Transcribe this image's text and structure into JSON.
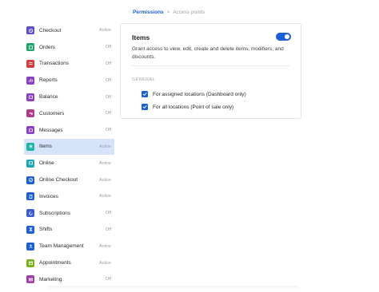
{
  "breadcrumb": {
    "link": "Permissions",
    "separator": ">",
    "current": "Access points"
  },
  "sidebar": {
    "items": [
      {
        "label": "Checkout",
        "status": "Active",
        "icon": "checkout-icon",
        "color": "#5b4bd6"
      },
      {
        "label": "Orders",
        "status": "Off",
        "icon": "orders-icon",
        "color": "#20a46b"
      },
      {
        "label": "Transactions",
        "status": "Off",
        "icon": "transactions-icon",
        "color": "#d93c3c"
      },
      {
        "label": "Reports",
        "status": "Off",
        "icon": "reports-icon",
        "color": "#8b3fc7"
      },
      {
        "label": "Balance",
        "status": "Off",
        "icon": "balance-icon",
        "color": "#8b3fc7"
      },
      {
        "label": "Customers",
        "status": "Off",
        "icon": "customers-icon",
        "color": "#b23a8a"
      },
      {
        "label": "Messages",
        "status": "Off",
        "icon": "messages-icon",
        "color": "#8b3fc7"
      },
      {
        "label": "Items",
        "status": "Active",
        "icon": "items-icon",
        "color": "#20b2aa",
        "selected": true
      },
      {
        "label": "Online",
        "status": "Active",
        "icon": "online-icon",
        "color": "#1aa6b7"
      },
      {
        "label": "Online Checkout",
        "status": "Active",
        "icon": "online-checkout-icon",
        "color": "#1a5fd6"
      },
      {
        "label": "Invoices",
        "status": "Active",
        "icon": "invoices-icon",
        "color": "#1a5fd6"
      },
      {
        "label": "Subscriptions",
        "status": "Off",
        "icon": "subscriptions-icon",
        "color": "#3b5bd6"
      },
      {
        "label": "Shifts",
        "status": "Off",
        "icon": "shifts-icon",
        "color": "#1a5fd6"
      },
      {
        "label": "Team Management",
        "status": "Active",
        "icon": "team-management-icon",
        "color": "#1a5fd6"
      },
      {
        "label": "Appointments",
        "status": "Active",
        "icon": "appointments-icon",
        "color": "#7ab317"
      },
      {
        "label": "Marketing",
        "status": "Off",
        "icon": "marketing-icon",
        "color": "#a23fa8"
      }
    ]
  },
  "card": {
    "title": "Items",
    "toggle_on": true,
    "description": "Grant access to view, edit, create and delete items, modifiers, and discounts.",
    "section_label": "GENERAL",
    "options": [
      {
        "label": "For assigned locations (Dashboard only)",
        "checked": true
      },
      {
        "label": "For all locations (Point of sale only)",
        "checked": true
      }
    ]
  },
  "colors": {
    "accent": "#1a5fd6",
    "selected_bg": "#d6e4fb"
  }
}
